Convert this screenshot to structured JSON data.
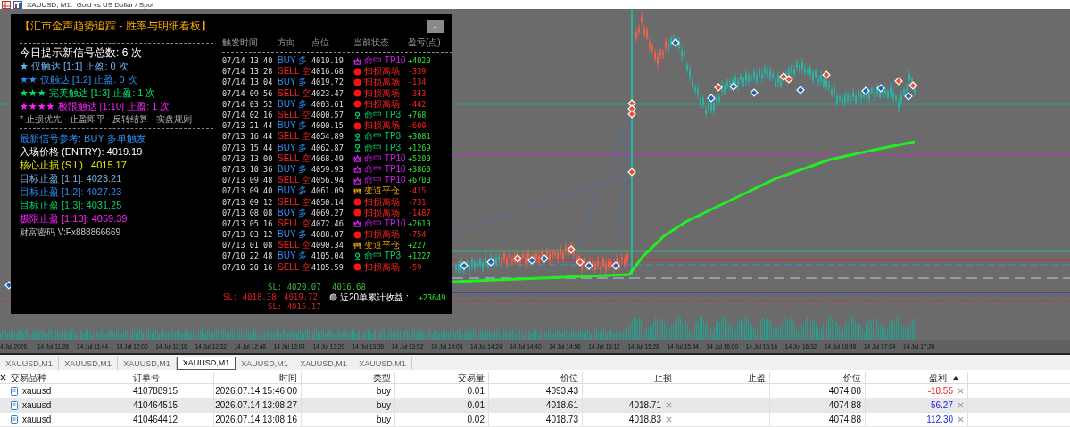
{
  "window": {
    "title": "XAUUSD, M1:  Gold vs US Dollar / Spot"
  },
  "panel": {
    "title": "【汇市金声趋势追踪 - 胜率与明细看板】",
    "minimize_button": "-",
    "stats": [
      {
        "text": "今日提示新信号总数: 6 次",
        "kind": "total"
      },
      {
        "text": "★ 仅触达 [1:1] 止盈: 0 次",
        "kind": "tp1"
      },
      {
        "text": "★★ 仅触达 [1:2] 止盈: 0 次",
        "kind": "tp2"
      },
      {
        "text": "★★★ 完美触达 [1:3] 止盈: 1 次",
        "kind": "tp3"
      },
      {
        "text": "★★★★ 极限触达 [1:10] 止盈: 1 次",
        "kind": "tp10"
      },
      {
        "text": "* 止损优先 · 止盈即平 · 反转结算 · 实盘规则",
        "kind": "note"
      }
    ],
    "signal": [
      {
        "text": "最新信号参考: BUY 多单触发",
        "kind": "signal"
      },
      {
        "text": "入场价格 (ENTRY): 4019.19",
        "kind": "entry"
      },
      {
        "text": "核心止损 (S L) : 4015.17",
        "kind": "sl"
      },
      {
        "text": "目标止盈 [1:1]: 4023.21",
        "kind": "tp1"
      },
      {
        "text": "目标止盈 [1:2]: 4027.23",
        "kind": "tp2"
      },
      {
        "text": "目标止盈 [1:3]: 4031.25",
        "kind": "tp3"
      },
      {
        "text": "极限止盈 [1:10]: 4059.39",
        "kind": "tp10"
      },
      {
        "text": "财富密码 V:Fx888866669",
        "kind": "note"
      }
    ],
    "columns": [
      "触发时间",
      "方向",
      "点位",
      "当前状态",
      "盈亏(点)"
    ],
    "rows": [
      {
        "time": "07/14 13:40",
        "direction": {
          "text": "BUY 多",
          "kind": "buy"
        },
        "price": "4019.19",
        "status": {
          "text": "命中 TP10",
          "kind": "tp10"
        },
        "pnl": "+4020",
        "loss": false
      },
      {
        "time": "07/14 13:28",
        "direction": {
          "text": "SELL 空",
          "kind": "sell"
        },
        "price": "4016.68",
        "status": {
          "text": "扫损离场",
          "kind": "sl"
        },
        "pnl": "-339",
        "loss": true
      },
      {
        "time": "07/14 13:04",
        "direction": {
          "text": "BUY 多",
          "kind": "buy"
        },
        "price": "4019.72",
        "status": {
          "text": "扫损离场",
          "kind": "sl"
        },
        "pnl": "-134",
        "loss": true
      },
      {
        "time": "07/14 09:56",
        "direction": {
          "text": "SELL 空",
          "kind": "sell"
        },
        "price": "4023.47",
        "status": {
          "text": "扫损离场",
          "kind": "sl"
        },
        "pnl": "-343",
        "loss": true
      },
      {
        "time": "07/14 03:52",
        "direction": {
          "text": "BUY 多",
          "kind": "buy"
        },
        "price": "4003.61",
        "status": {
          "text": "扫损离场",
          "kind": "sl"
        },
        "pnl": "-442",
        "loss": true
      },
      {
        "time": "07/14 02:16",
        "direction": {
          "text": "SELL 空",
          "kind": "sell"
        },
        "price": "4000.57",
        "status": {
          "text": "命中 TP3",
          "kind": "tp3"
        },
        "pnl": "+768",
        "loss": false
      },
      {
        "time": "07/13 21:44",
        "direction": {
          "text": "BUY 多",
          "kind": "buy"
        },
        "price": "4000.15",
        "status": {
          "text": "扫损离场",
          "kind": "sl"
        },
        "pnl": "-609",
        "loss": true
      },
      {
        "time": "07/13 16:44",
        "direction": {
          "text": "SELL 空",
          "kind": "sell"
        },
        "price": "4054.89",
        "status": {
          "text": "命中 TP3",
          "kind": "tp3"
        },
        "pnl": "+3081",
        "loss": false
      },
      {
        "time": "07/13 15:44",
        "direction": {
          "text": "BUY 多",
          "kind": "buy"
        },
        "price": "4062.87",
        "status": {
          "text": "命中 TP3",
          "kind": "tp3"
        },
        "pnl": "+1269",
        "loss": false
      },
      {
        "time": "07/13 13:00",
        "direction": {
          "text": "SELL 空",
          "kind": "sell"
        },
        "price": "4068.49",
        "status": {
          "text": "命中 TP10",
          "kind": "tp10"
        },
        "pnl": "+5200",
        "loss": false
      },
      {
        "time": "07/13 10:36",
        "direction": {
          "text": "BUY 多",
          "kind": "buy"
        },
        "price": "4059.93",
        "status": {
          "text": "命中 TP10",
          "kind": "tp10"
        },
        "pnl": "+3860",
        "loss": false
      },
      {
        "time": "07/13 09:48",
        "direction": {
          "text": "SELL 空",
          "kind": "sell"
        },
        "price": "4056.94",
        "status": {
          "text": "命中 TP10",
          "kind": "tp10"
        },
        "pnl": "+6700",
        "loss": false
      },
      {
        "time": "07/13 09:40",
        "direction": {
          "text": "BUY 多",
          "kind": "buy"
        },
        "price": "4061.09",
        "status": {
          "text": "变道平仓",
          "kind": "be"
        },
        "pnl": "-415",
        "loss": true
      },
      {
        "time": "07/13 09:12",
        "direction": {
          "text": "SELL 空",
          "kind": "sell"
        },
        "price": "4050.14",
        "status": {
          "text": "扫损离场",
          "kind": "sl"
        },
        "pnl": "-731",
        "loss": true
      },
      {
        "time": "07/13 08:08",
        "direction": {
          "text": "BUY 多",
          "kind": "buy"
        },
        "price": "4069.27",
        "status": {
          "text": "扫损离场",
          "kind": "sl"
        },
        "pnl": "-1487",
        "loss": true
      },
      {
        "time": "07/13 05:16",
        "direction": {
          "text": "SELL 空",
          "kind": "sell"
        },
        "price": "4072.46",
        "status": {
          "text": "命中 TP10",
          "kind": "tp10"
        },
        "pnl": "+2610",
        "loss": false
      },
      {
        "time": "07/13 03:12",
        "direction": {
          "text": "BUY 多",
          "kind": "buy"
        },
        "price": "4088.07",
        "status": {
          "text": "扫损离场",
          "kind": "sl"
        },
        "pnl": "-754",
        "loss": true
      },
      {
        "time": "07/13 01:08",
        "direction": {
          "text": "SELL 空",
          "kind": "sell"
        },
        "price": "4090.34",
        "status": {
          "text": "变道平仓",
          "kind": "be"
        },
        "pnl": "+227",
        "loss": false
      },
      {
        "time": "07/10 22:48",
        "direction": {
          "text": "BUY 多",
          "kind": "buy"
        },
        "price": "4105.04",
        "status": {
          "text": "命中 TP3",
          "kind": "tp3"
        },
        "pnl": "+1227",
        "loss": false
      },
      {
        "time": "07/10 20:16",
        "direction": {
          "text": "SELL 空",
          "kind": "sell"
        },
        "price": "4105.59",
        "status": {
          "text": "扫损离场",
          "kind": "sl"
        },
        "pnl": "-59",
        "loss": true
      }
    ],
    "summary": {
      "label": "近20单累计收益 :",
      "value": "+23649"
    }
  },
  "chart": {
    "labels": [
      {
        "text": "SL: 4020.07",
        "color": "#40b840"
      },
      {
        "text": "SL: 4018.38",
        "color": "#e02020"
      },
      {
        "text": "4019.72",
        "color": "#e02020"
      },
      {
        "text": "4016.68",
        "color": "#40b840"
      },
      {
        "text": "SL: 4015.17",
        "color": "#e02020"
      }
    ]
  },
  "time_axis": [
    "4 Jul 2026",
    "14 Jul 11:28",
    "14 Jul 11:44",
    "14 Jul 12:00",
    "14 Jul 12:16",
    "14 Jul 12:32",
    "14 Jul 12:48",
    "14 Jul 13:04",
    "14 Jul 13:20",
    "14 Jul 13:36",
    "14 Jul 13:52",
    "14 Jul 14:08",
    "14 Jul 14:24",
    "14 Jul 14:40",
    "14 Jul 14:56",
    "14 Jul 15:12",
    "14 Jul 15:28",
    "14 Jul 15:44",
    "14 Jul 16:00",
    "14 Jul 16:16",
    "14 Jul 16:32",
    "14 Jul 16:48",
    "14 Jul 17:04",
    "14 Jul 17:20"
  ],
  "tabs": [
    {
      "label": "XAUUSD,M1",
      "selected": false
    },
    {
      "label": "XAUUSD,M1",
      "selected": false
    },
    {
      "label": "XAUUSD,M1",
      "selected": false
    },
    {
      "label": "XAUUSD,M1",
      "selected": true
    },
    {
      "label": "XAUUSD,M1",
      "selected": false
    },
    {
      "label": "XAUUSD,M1",
      "selected": false
    },
    {
      "label": "XAUUSD,M1",
      "selected": false
    }
  ],
  "orders": {
    "columns": [
      "交易品种",
      "订单号",
      "时间",
      "类型",
      "交易量",
      "价位",
      "止损",
      "止盈",
      "价位",
      "盈利"
    ],
    "rows": [
      {
        "symbol": "xauusd",
        "order": "410788915",
        "time": "2026.07.14 15:46:00",
        "type": "buy",
        "volume": "0.01",
        "price": "4093.43",
        "current_price": "4074.88",
        "profit": "-18.55",
        "loss": true,
        "selected": false
      },
      {
        "symbol": "xauusd",
        "order": "410464515",
        "time": "2026.07.14 13:08:27",
        "type": "buy",
        "volume": "0.01",
        "price": "4018.61",
        "sl": "4018.71",
        "current_price": "4074.88",
        "profit": "56.27",
        "loss": false,
        "selected": true
      },
      {
        "symbol": "xauusd",
        "order": "410464412",
        "time": "2026.07.14 13:08:16",
        "type": "buy",
        "volume": "0.02",
        "price": "4018.73",
        "sl": "4018.83",
        "current_price": "4074.88",
        "profit": "112.30",
        "loss": false,
        "selected": false
      }
    ]
  }
}
